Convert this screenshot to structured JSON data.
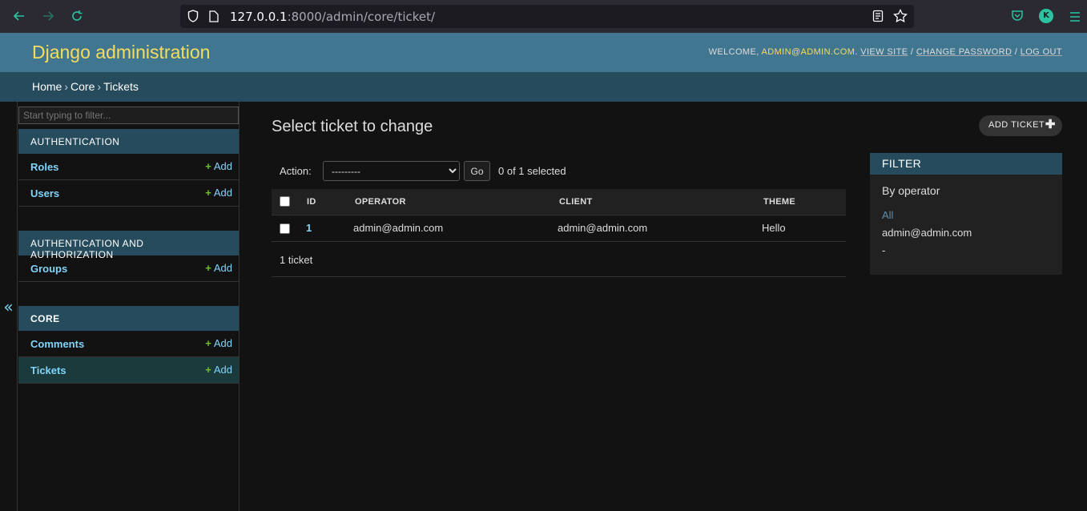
{
  "browser": {
    "url_host": "127.0.0.1",
    "url_rest": ":8000/admin/core/ticket/",
    "avatar_letter": "K"
  },
  "header": {
    "branding": "Django administration",
    "welcome": "WELCOME, ",
    "user": "ADMIN@ADMIN.COM",
    "view_site": "VIEW SITE",
    "change_password": "CHANGE PASSWORD",
    "log_out": "LOG OUT"
  },
  "breadcrumbs": {
    "home": "Home",
    "app": "Core",
    "model": "Tickets"
  },
  "sidebar": {
    "filter_placeholder": "Start typing to filter...",
    "collapse_glyph": "«",
    "modules": [
      {
        "caption": "AUTHENTICATION",
        "rows": [
          {
            "name": "Roles",
            "add": "Add"
          },
          {
            "name": "Users",
            "add": "Add"
          }
        ]
      },
      {
        "caption": "AUTHENTICATION AND AUTHORIZATION",
        "rows": [
          {
            "name": "Groups",
            "add": "Add"
          }
        ]
      },
      {
        "caption": "CORE",
        "rows": [
          {
            "name": "Comments",
            "add": "Add"
          },
          {
            "name": "Tickets",
            "add": "Add"
          }
        ]
      }
    ]
  },
  "main": {
    "title": "Select ticket to change",
    "add_button": "ADD TICKET",
    "action_label": "Action:",
    "action_selected": "---------",
    "go": "Go",
    "selected_count": "0 of 1 selected",
    "columns": [
      "ID",
      "OPERATOR",
      "CLIENT",
      "THEME"
    ],
    "rows": [
      {
        "id": "1",
        "operator": "admin@admin.com",
        "client": "admin@admin.com",
        "theme": "Hello"
      }
    ],
    "paginator": "1 ticket"
  },
  "filter": {
    "caption": "FILTER",
    "by": "By operator",
    "choices": [
      "All",
      "admin@admin.com",
      "-"
    ]
  },
  "colors": {
    "header": "#417690",
    "breadcrumbs": "#264b5d",
    "link": "#81d4fa",
    "add_plus": "#70bf2b",
    "branding": "#f5dd5d"
  }
}
